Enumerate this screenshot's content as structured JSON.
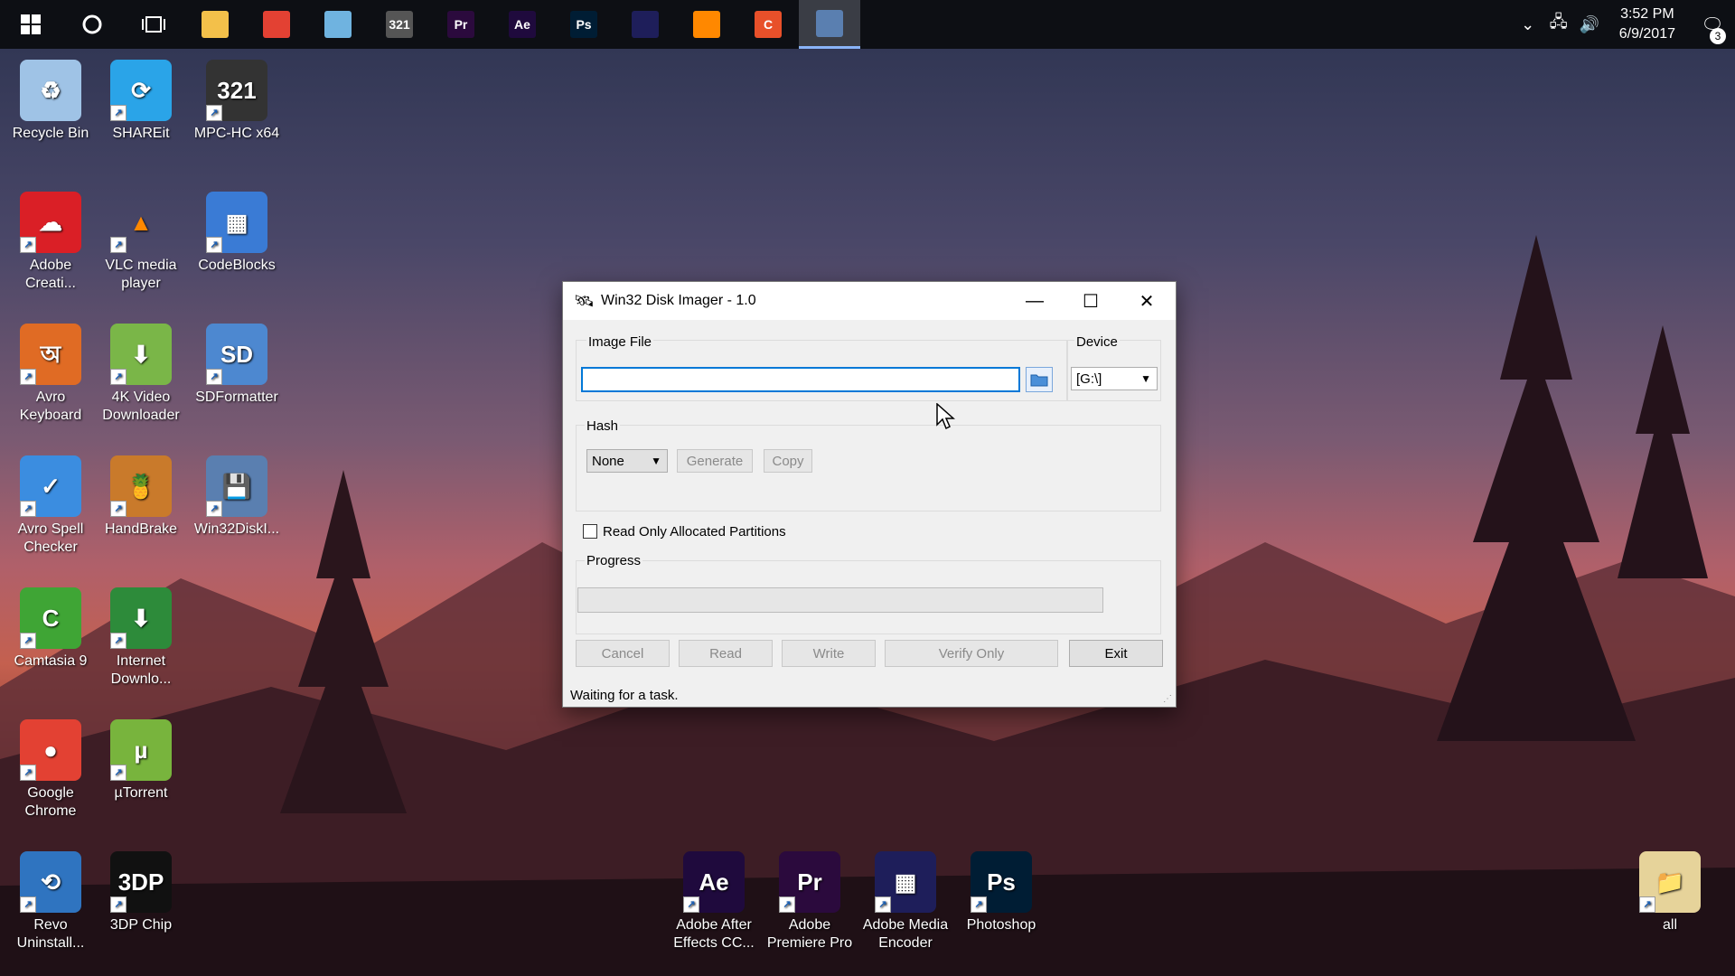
{
  "taskbar": {
    "start_label": "Start",
    "apps": [
      {
        "name": "file-explorer",
        "label": "",
        "color": "#f3c04a"
      },
      {
        "name": "chrome",
        "label": "",
        "color": "#e34133"
      },
      {
        "name": "paper",
        "label": "",
        "color": "#6fb3e0"
      },
      {
        "name": "mpc",
        "label": "321",
        "color": "#555"
      },
      {
        "name": "premiere",
        "label": "Pr",
        "color": "#2b0a3d"
      },
      {
        "name": "after-effects",
        "label": "Ae",
        "color": "#1f0a3d"
      },
      {
        "name": "photoshop",
        "label": "Ps",
        "color": "#001d34"
      },
      {
        "name": "media-encoder",
        "label": "",
        "color": "#1e1e5a"
      },
      {
        "name": "vlc",
        "label": "",
        "color": "#ff8800"
      },
      {
        "name": "camtasia",
        "label": "C",
        "color": "#e8502a"
      },
      {
        "name": "win32diskimager",
        "label": "",
        "color": "#5a7fb0"
      }
    ],
    "clock_time": "3:52 PM",
    "clock_date": "6/9/2017",
    "notification_count": "3"
  },
  "desktop": {
    "icons": [
      {
        "label": "Recycle Bin"
      },
      {
        "label": "SHAREit"
      },
      {
        "label": "MPC-HC x64"
      },
      {
        "label": "Adobe Creati..."
      },
      {
        "label": "VLC media player"
      },
      {
        "label": "CodeBlocks"
      },
      {
        "label": "Avro Keyboard"
      },
      {
        "label": "4K Video Downloader"
      },
      {
        "label": "SDFormatter"
      },
      {
        "label": "Avro Spell Checker"
      },
      {
        "label": "HandBrake"
      },
      {
        "label": "Win32DiskI..."
      },
      {
        "label": "Camtasia 9"
      },
      {
        "label": "Internet Downlo..."
      },
      {
        "label": "Google Chrome"
      },
      {
        "label": "µTorrent"
      },
      {
        "label": "Revo Uninstall..."
      },
      {
        "label": "3DP Chip"
      },
      {
        "label": "Adobe After Effects CC..."
      },
      {
        "label": "Adobe Premiere Pro"
      },
      {
        "label": "Adobe Media Encoder"
      },
      {
        "label": "Photoshop"
      },
      {
        "label": "all"
      }
    ]
  },
  "dialog": {
    "title": "Win32 Disk Imager - 1.0",
    "image_file_label": "Image File",
    "image_file_value": "",
    "device_label": "Device",
    "device_value": "[G:\\]",
    "hash_label": "Hash",
    "hash_value": "None",
    "generate_label": "Generate",
    "copy_label": "Copy",
    "read_only_label": "Read Only Allocated Partitions",
    "read_only_checked": false,
    "progress_label": "Progress",
    "progress_value": 0,
    "cancel_label": "Cancel",
    "read_label": "Read",
    "write_label": "Write",
    "verify_label": "Verify Only",
    "exit_label": "Exit",
    "status_text": "Waiting for a task."
  }
}
